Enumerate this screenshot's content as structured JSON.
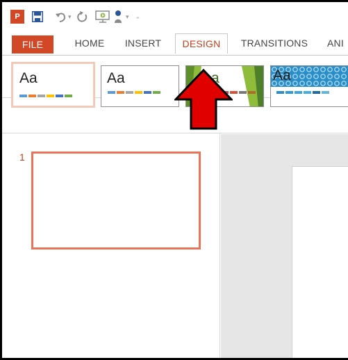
{
  "app": {
    "logo_text": "P"
  },
  "qat": {
    "icons": [
      "powerpoint-logo-icon",
      "save-icon",
      "undo-icon",
      "repeat-icon",
      "start-from-beginning-icon",
      "touch-mode-icon",
      "customize-qat-icon"
    ]
  },
  "tabs": [
    {
      "label": "FILE"
    },
    {
      "label": "HOME"
    },
    {
      "label": "INSERT"
    },
    {
      "label": "DESIGN"
    },
    {
      "label": "TRANSITIONS"
    },
    {
      "label": "ANI"
    }
  ],
  "themes": [
    {
      "label": "Aa",
      "swatches": [
        "#5b9bd5",
        "#ed7d31",
        "#a5a5a5",
        "#ffc000",
        "#4472c4",
        "#70ad47"
      ]
    },
    {
      "label": "Aa",
      "swatches": [
        "#5b9bd5",
        "#ed7d31",
        "#a5a5a5",
        "#ffc000",
        "#4472c4",
        "#70ad47"
      ]
    },
    {
      "label": "Aa",
      "swatches": [
        "#8fbc3a",
        "#4e7f2a",
        "#c0504d",
        "#d6513a",
        "#7a7a7a",
        "#b06a2a"
      ]
    },
    {
      "label": "Aa",
      "swatches": [
        "#2a8fc9",
        "#2f9bd6",
        "#3aa6dc",
        "#40b0e0",
        "#1e6e9c",
        "#5fb8d8"
      ]
    }
  ],
  "slides": [
    {
      "number": "1"
    }
  ],
  "colors": {
    "accent": "#d24726",
    "arrow": "#e00000"
  }
}
